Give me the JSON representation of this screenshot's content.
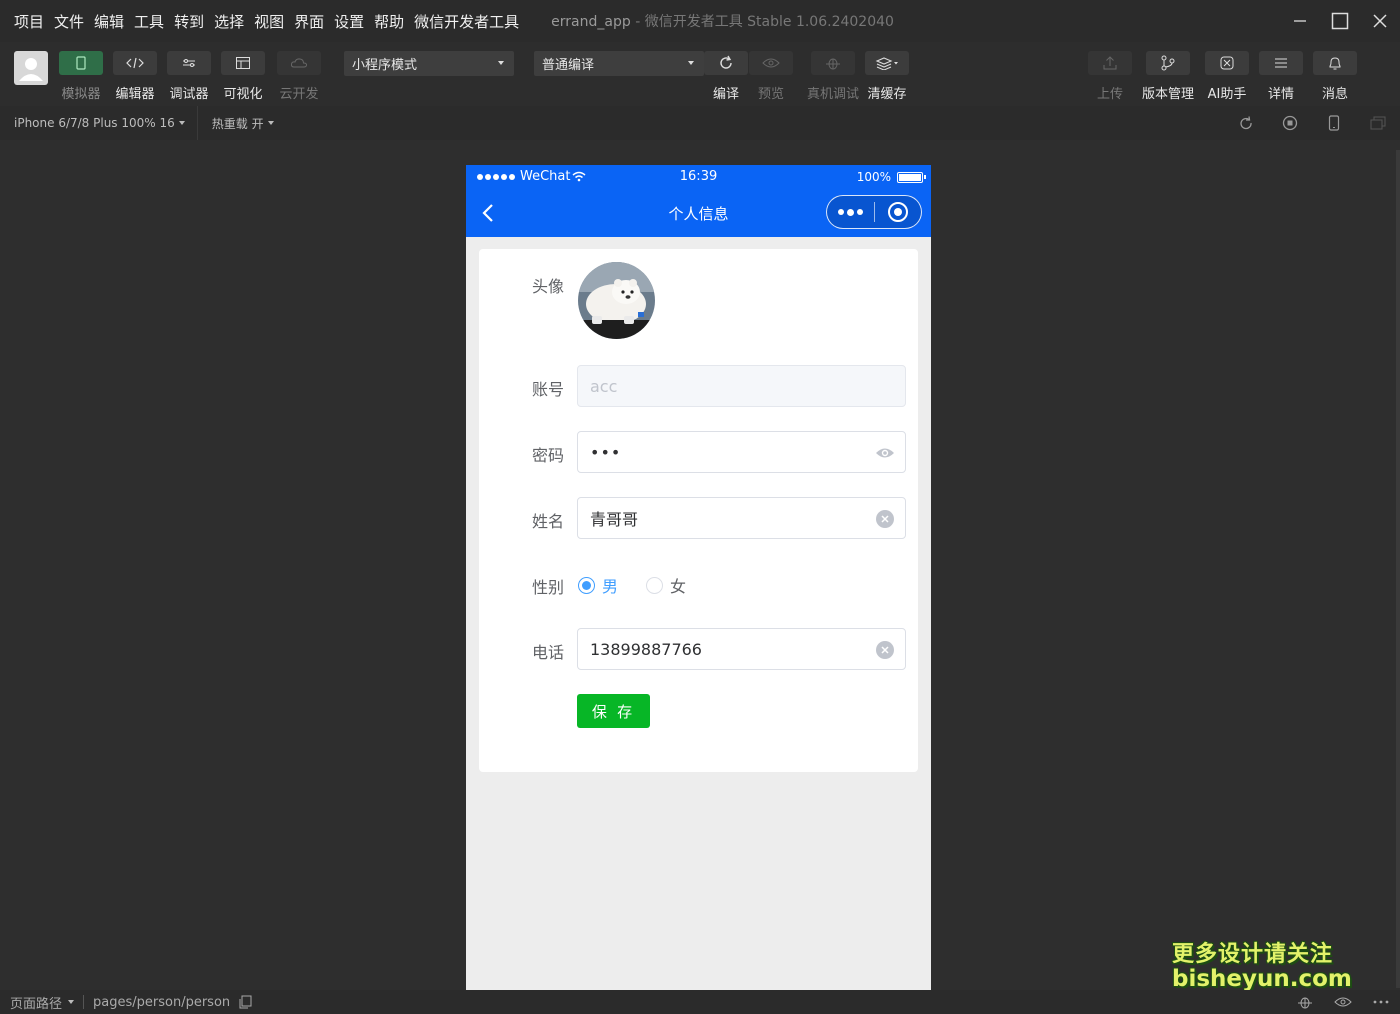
{
  "menu": {
    "items": [
      "项目",
      "文件",
      "编辑",
      "工具",
      "转到",
      "选择",
      "视图",
      "界面",
      "设置",
      "帮助",
      "微信开发者工具"
    ],
    "window_title": "errand_app",
    "window_subtitle": " - 微信开发者工具 Stable 1.06.2402040"
  },
  "toolbar": {
    "simulator_label": "模拟器",
    "editor_label": "编辑器",
    "debugger_label": "调试器",
    "visual_label": "可视化",
    "cloud_label": "云开发",
    "mode_select": "小程序模式",
    "compile_select": "普通编译",
    "compile_label": "编译",
    "preview_label": "预览",
    "remote_debug_label": "真机调试",
    "clear_cache_label": "清缓存",
    "upload_label": "上传",
    "version_label": "版本管理",
    "ai_label": "AI助手",
    "details_label": "详情",
    "messages_label": "消息"
  },
  "subbar": {
    "device": "iPhone 6/7/8 Plus 100% 16",
    "hot_reload": "热重载 开"
  },
  "phone": {
    "carrier": "WeChat",
    "time": "16:39",
    "battery": "100%",
    "nav_title": "个人信息"
  },
  "form": {
    "avatar_label": "头像",
    "account_label": "账号",
    "account_value": "acc",
    "password_label": "密码",
    "password_value": "•••",
    "name_label": "姓名",
    "name_value": "青哥哥",
    "gender_label": "性别",
    "gender_options": [
      "男",
      "女"
    ],
    "gender_selected": "男",
    "phone_label": "电话",
    "phone_value": "13899887766",
    "save_label": "保 存"
  },
  "watermark": {
    "line1": "更多设计请关注",
    "line2": "bisheyun.com"
  },
  "bottombar": {
    "page_path_label": "页面路径",
    "page_path": "pages/person/person"
  },
  "colors": {
    "nav_blue": "#0a64f5",
    "save_green": "#07b626",
    "radio_blue": "#409eff"
  }
}
